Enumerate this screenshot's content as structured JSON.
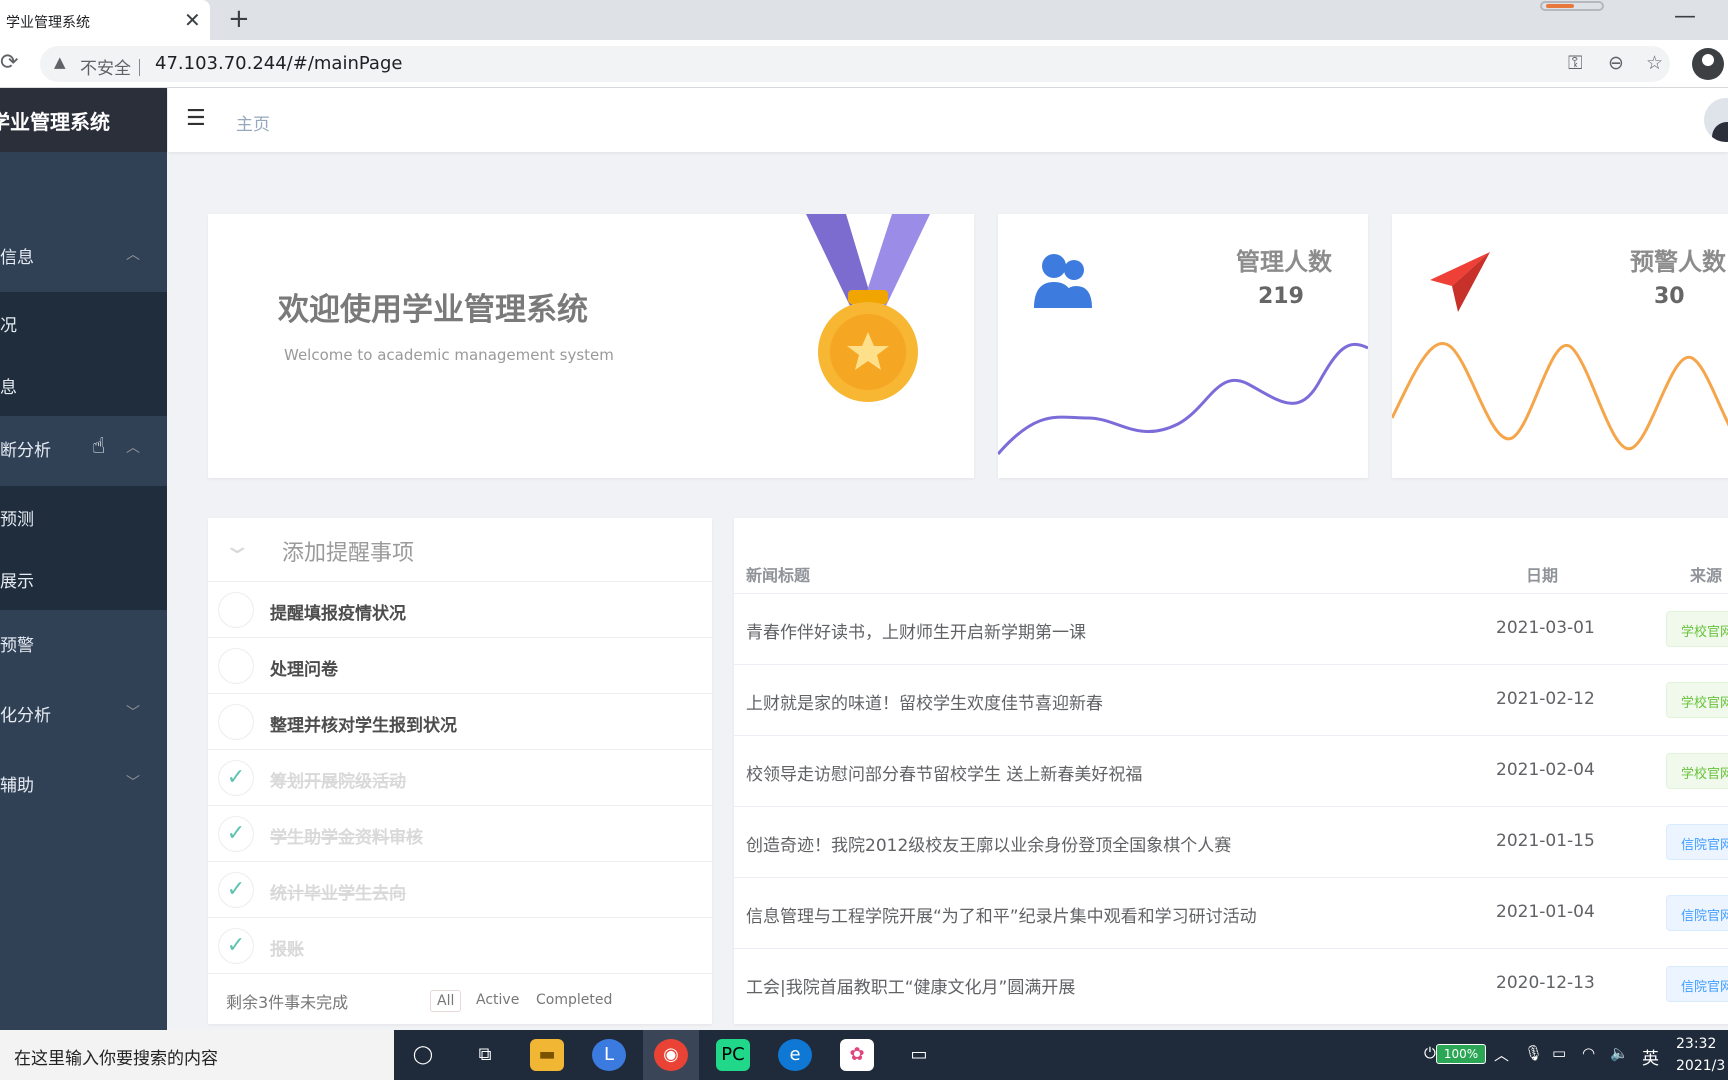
{
  "browser": {
    "tab_title": "学业管理系统",
    "tab_close": "✕",
    "new_tab": "+",
    "minimize": "—",
    "insecure_label": "不安全｜",
    "url": "47.103.70.244/#/mainPage"
  },
  "sidebar": {
    "brand": "学业管理系统",
    "items": [
      {
        "label": "信息",
        "chevron": "︿"
      },
      {
        "label": "况"
      },
      {
        "label": "息"
      },
      {
        "label": "断分析",
        "chevron": "︿"
      },
      {
        "label": "预测"
      },
      {
        "label": "展示"
      },
      {
        "label": "预警"
      },
      {
        "label": "化分析",
        "chevron": "﹀"
      },
      {
        "label": "辅助",
        "chevron": "﹀"
      }
    ]
  },
  "header": {
    "breadcrumb": "主页"
  },
  "welcome": {
    "title": "欢迎使用学业管理系统",
    "subtitle": "Welcome to academic management system"
  },
  "stats": [
    {
      "label": "管理人数",
      "value": "219",
      "color": "#7b6cd9"
    },
    {
      "label": "预警人数",
      "value": "30",
      "color": "#f5a54a"
    }
  ],
  "todo": {
    "placeholder": "添加提醒事项",
    "items": [
      {
        "text": "提醒填报疫情状况",
        "done": false
      },
      {
        "text": "处理问卷",
        "done": false
      },
      {
        "text": "整理并核对学生报到状况",
        "done": false
      },
      {
        "text": "筹划开展院级活动",
        "done": true
      },
      {
        "text": "学生助学金资料审核",
        "done": true
      },
      {
        "text": "统计毕业学生去向",
        "done": true
      },
      {
        "text": "报账",
        "done": true
      }
    ],
    "remaining": "剩余3件事未完成",
    "filters": [
      "All",
      "Active",
      "Completed"
    ],
    "check_mark": "✓"
  },
  "news": {
    "headers": [
      "新闻标题",
      "日期",
      "来源"
    ],
    "rows": [
      {
        "title": "青春作伴好读书，上财师生开启新学期第一课",
        "date": "2021-03-01",
        "source": "学校官网",
        "tag": "green"
      },
      {
        "title": "上财就是家的味道！留校学生欢度佳节喜迎新春",
        "date": "2021-02-12",
        "source": "学校官网",
        "tag": "green"
      },
      {
        "title": "校领导走访慰问部分春节留校学生 送上新春美好祝福",
        "date": "2021-02-04",
        "source": "学校官网",
        "tag": "green"
      },
      {
        "title": "创造奇迹！我院2012级校友王廓以业余身份登顶全国象棋个人赛",
        "date": "2021-01-15",
        "source": "信院官网",
        "tag": "blue"
      },
      {
        "title": "信息管理与工程学院开展“为了和平”纪录片集中观看和学习研讨活动",
        "date": "2021-01-04",
        "source": "信院官网",
        "tag": "blue"
      },
      {
        "title": "工会|我院首届教职工“健康文化月”圆满开展",
        "date": "2020-12-13",
        "source": "信院官网",
        "tag": "blue"
      }
    ]
  },
  "taskbar": {
    "search_placeholder": "在这里输入你要搜索的内容",
    "battery": "100%",
    "ime": "英",
    "time": "23:32",
    "date": "2021/3"
  }
}
